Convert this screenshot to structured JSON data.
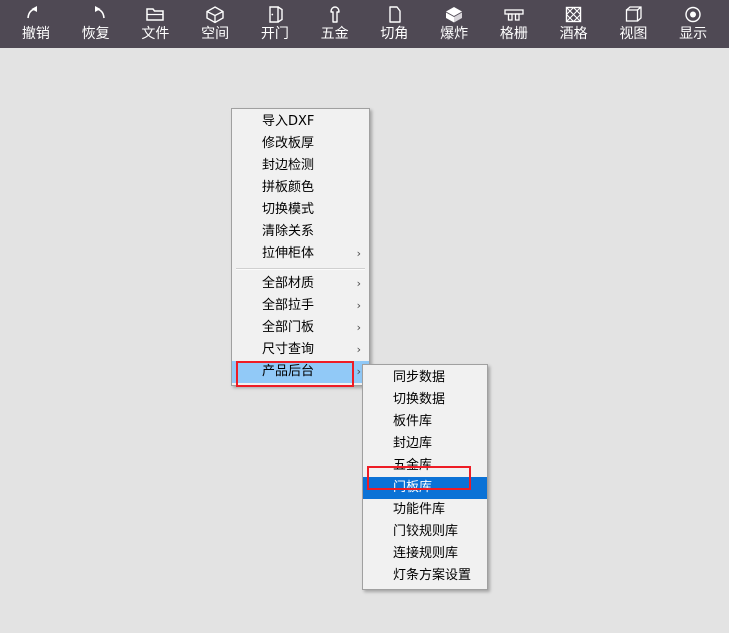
{
  "toolbar": {
    "background_color": "#4f4954",
    "items": [
      {
        "label": "撤销",
        "icon": "undo-arrow-icon"
      },
      {
        "label": "恢复",
        "icon": "redo-arrow-icon"
      },
      {
        "label": "文件",
        "icon": "folder-icon"
      },
      {
        "label": "空间",
        "icon": "cube-icon"
      },
      {
        "label": "开门",
        "icon": "open-door-icon"
      },
      {
        "label": "五金",
        "icon": "hardware-screw-icon"
      },
      {
        "label": "切角",
        "icon": "corner-cut-icon"
      },
      {
        "label": "爆炸",
        "icon": "explode-box-icon"
      },
      {
        "label": "格栅",
        "icon": "grille-icon"
      },
      {
        "label": "酒格",
        "icon": "wine-rack-icon"
      },
      {
        "label": "视图",
        "icon": "wireframe-cube-icon"
      },
      {
        "label": "显示",
        "icon": "eye-icon"
      }
    ]
  },
  "context_menu": {
    "items": [
      {
        "label": "导入DXF",
        "submenu": false,
        "highlighted": false
      },
      {
        "label": "修改板厚",
        "submenu": false,
        "highlighted": false
      },
      {
        "label": "封边检测",
        "submenu": false,
        "highlighted": false
      },
      {
        "label": "拼板颜色",
        "submenu": false,
        "highlighted": false
      },
      {
        "label": "切换模式",
        "submenu": false,
        "highlighted": false
      },
      {
        "label": "清除关系",
        "submenu": false,
        "highlighted": false
      },
      {
        "label": "拉伸柜体",
        "submenu": true,
        "highlighted": false
      },
      {
        "separator": true
      },
      {
        "label": "全部材质",
        "submenu": true,
        "highlighted": false
      },
      {
        "label": "全部拉手",
        "submenu": true,
        "highlighted": false
      },
      {
        "label": "全部门板",
        "submenu": true,
        "highlighted": false
      },
      {
        "label": "尺寸查询",
        "submenu": true,
        "highlighted": false
      },
      {
        "label": "产品后台",
        "submenu": true,
        "highlighted": "light"
      }
    ],
    "submenu_arrow": "›"
  },
  "sub_menu": {
    "items": [
      {
        "label": "同步数据",
        "highlighted": false
      },
      {
        "label": "切换数据",
        "highlighted": false
      },
      {
        "label": "板件库",
        "highlighted": false
      },
      {
        "label": "封边库",
        "highlighted": false
      },
      {
        "label": "五金库",
        "highlighted": false
      },
      {
        "label": "门板库",
        "highlighted": "strong"
      },
      {
        "label": "功能件库",
        "highlighted": false
      },
      {
        "label": "门铰规则库",
        "highlighted": false
      },
      {
        "label": "连接规则库",
        "highlighted": false
      },
      {
        "label": "灯条方案设置",
        "highlighted": false
      }
    ]
  },
  "annotations": {
    "color": "#ee1c25",
    "boxes": [
      {
        "name": "annotation-box-product-backend",
        "target": "产品后台"
      },
      {
        "name": "annotation-box-door-panel-library",
        "target": "门板库"
      }
    ]
  },
  "colors": {
    "canvas_background": "#e3e3e3",
    "menu_background": "#f1f1f1",
    "highlight_light": "#91c9f7",
    "highlight_strong": "#0b72d6",
    "annotation_red": "#ee1c25"
  }
}
